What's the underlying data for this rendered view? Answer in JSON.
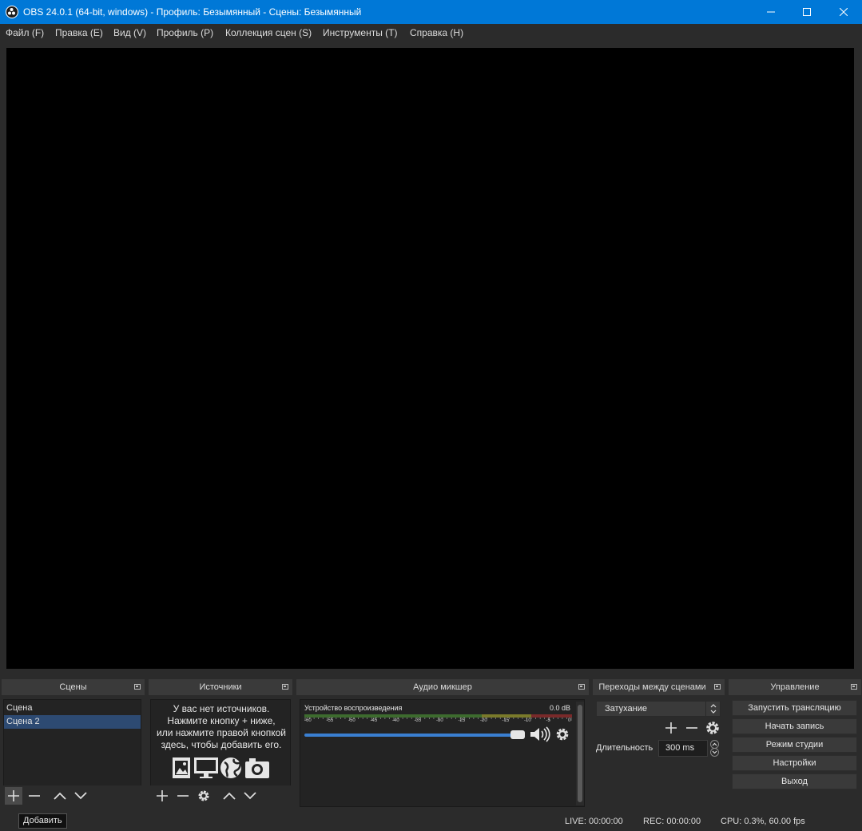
{
  "window": {
    "title": "OBS 24.0.1 (64-bit, windows) - Профиль: Безымянный - Сцены: Безымянный"
  },
  "menu": [
    "Файл (F)",
    "Правка (E)",
    "Вид (V)",
    "Профиль (P)",
    "Коллекция сцен (S)",
    "Инструменты (T)",
    "Справка (H)"
  ],
  "docks": {
    "scenes": {
      "title": "Сцены",
      "items": [
        {
          "label": "Сцена"
        },
        {
          "label": "Сцена 2",
          "selected": true
        }
      ]
    },
    "sources": {
      "title": "Источники",
      "empty_message": "У вас нет источников.\nНажмите кнопку + ниже,\nили нажмите правой кнопкой\nздесь, чтобы добавить его."
    },
    "audio": {
      "title": "Аудио микшер",
      "device_name": "Устройство воспроизведения",
      "level_label": "0.0 dB",
      "volume": 1.0,
      "scale": [
        "-60",
        "-55",
        "-50",
        "-45",
        "-40",
        "-35",
        "-30",
        "-25",
        "-20",
        "-15",
        "-10",
        "-5",
        "0"
      ]
    },
    "transitions": {
      "title": "Переходы между сценами",
      "selected": "Затухание",
      "duration_label": "Длительность",
      "duration_value": "300 ms"
    },
    "controls": {
      "title": "Управление",
      "buttons": [
        "Запустить трансляцию",
        "Начать запись",
        "Режим студии",
        "Настройки",
        "Выход"
      ]
    }
  },
  "tooltip": "Добавить",
  "status": {
    "live": "LIVE: 00:00:00",
    "rec": "REC: 00:00:00",
    "cpu": "CPU: 0.3%, 60.00 fps"
  },
  "colors": {
    "titlebar": "#0078d7",
    "selection": "#2d4a72",
    "volume": "#3a7fd1"
  }
}
